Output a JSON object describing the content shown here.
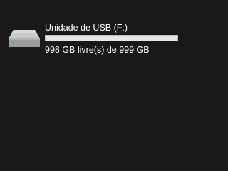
{
  "drive": {
    "name": "Unidade de USB (F:)",
    "space_text": "998 GB livre(s) de 999 GB",
    "used_fraction": 0.001,
    "icon": "usb-drive-icon",
    "colors": {
      "background": "#191919",
      "bar_track": "#e6e6e6",
      "bar_fill": "#26a0da",
      "led": "#35d12e"
    }
  }
}
